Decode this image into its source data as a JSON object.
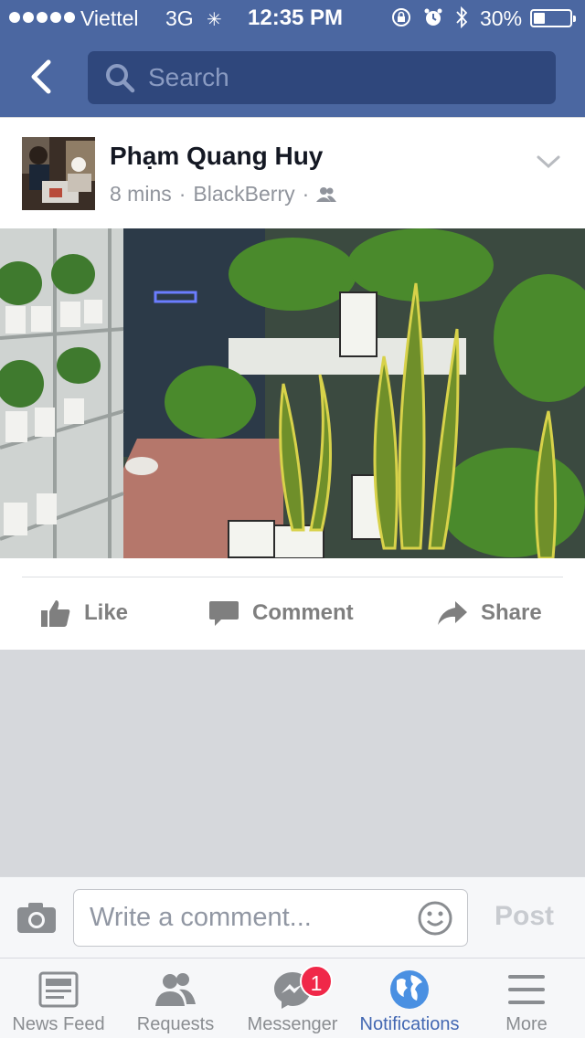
{
  "status_bar": {
    "carrier": "Viettel",
    "network": "3G",
    "time": "12:35 PM",
    "battery_percent": "30%",
    "battery_level": 0.3
  },
  "nav": {
    "search_placeholder": "Search"
  },
  "post": {
    "author": "Phạm Quang Huy",
    "time": "8 mins",
    "source": "BlackBerry",
    "separator": "·",
    "privacy_icon": "friends-icon",
    "actions": {
      "like": "Like",
      "comment": "Comment",
      "share": "Share"
    }
  },
  "comment_bar": {
    "placeholder": "Write a comment...",
    "post_label": "Post"
  },
  "tabs": [
    {
      "label": "News Feed",
      "icon": "news-feed-icon"
    },
    {
      "label": "Requests",
      "icon": "requests-icon"
    },
    {
      "label": "Messenger",
      "icon": "messenger-icon",
      "badge": "1"
    },
    {
      "label": "Notifications",
      "icon": "globe-icon",
      "active": true
    },
    {
      "label": "More",
      "icon": "menu-icon"
    }
  ],
  "colors": {
    "brand_blue": "#4b67a1",
    "active_tab": "#4267b2",
    "badge_red": "#f02849",
    "feed_background": "#d6d8dc"
  }
}
